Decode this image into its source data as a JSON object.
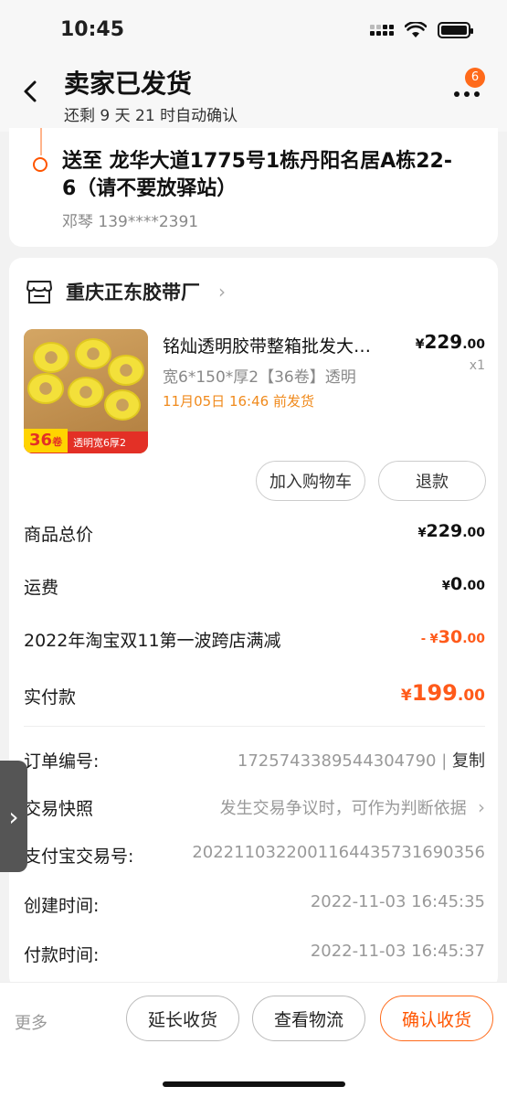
{
  "status_bar": {
    "time": "10:45"
  },
  "header": {
    "title": "卖家已发货",
    "subtitle": "还剩 9 天 21 时自动确认",
    "badge_count": "6"
  },
  "address": {
    "text": "送至 龙华大道1775号1栋丹阳名居A栋22-6（请不要放驿站）",
    "person": "邓琴 139****2391"
  },
  "shop": {
    "name": "重庆正东胶带厂"
  },
  "product": {
    "title": "铭灿透明胶带整箱批发大…",
    "sku": "宽6*150*厚2【36卷】透明",
    "ship_deadline": "11月05日 16:46 前发货",
    "price_currency": "¥",
    "price_int": "229",
    "price_dec": ".00",
    "quantity": "x1",
    "image_badge_big": "36",
    "image_badge_unit": "卷",
    "image_badge_small": "透明宽6厚2"
  },
  "actions": {
    "add_to_cart": "加入购物车",
    "refund": "退款"
  },
  "summary": {
    "goods_total_label": "商品总价",
    "goods_total_currency": "¥",
    "goods_total_int": "229",
    "goods_total_dec": ".00",
    "shipping_label": "运费",
    "shipping_currency": "¥",
    "shipping_int": "0",
    "shipping_dec": ".00",
    "discount_label": "2022年淘宝双11第一波跨店满减",
    "discount_prefix": "- ¥",
    "discount_int": "30",
    "discount_dec": ".00",
    "paid_label": "实付款",
    "paid_currency": "¥",
    "paid_int": "199",
    "paid_dec": ".00"
  },
  "info": {
    "order_no_label": "订单编号:",
    "order_no": "1725743389544304790",
    "copy": "复制",
    "snapshot_label": "交易快照",
    "snapshot_value": "发生交易争议时，可作为判断依据",
    "alipay_label": "支付宝交易号:",
    "alipay_no": "2022110322001164435731690356",
    "created_label": "创建时间:",
    "created_value": "2022-11-03 16:45:35",
    "paid_time_label": "付款时间:",
    "paid_time_value": "2022-11-03 16:45:37"
  },
  "bottom_bar": {
    "more": "更多",
    "extend": "延长收货",
    "logistics": "查看物流",
    "confirm": "确认收货"
  },
  "colors": {
    "accent": "#ff5500",
    "ship_note": "#f08a1c"
  }
}
